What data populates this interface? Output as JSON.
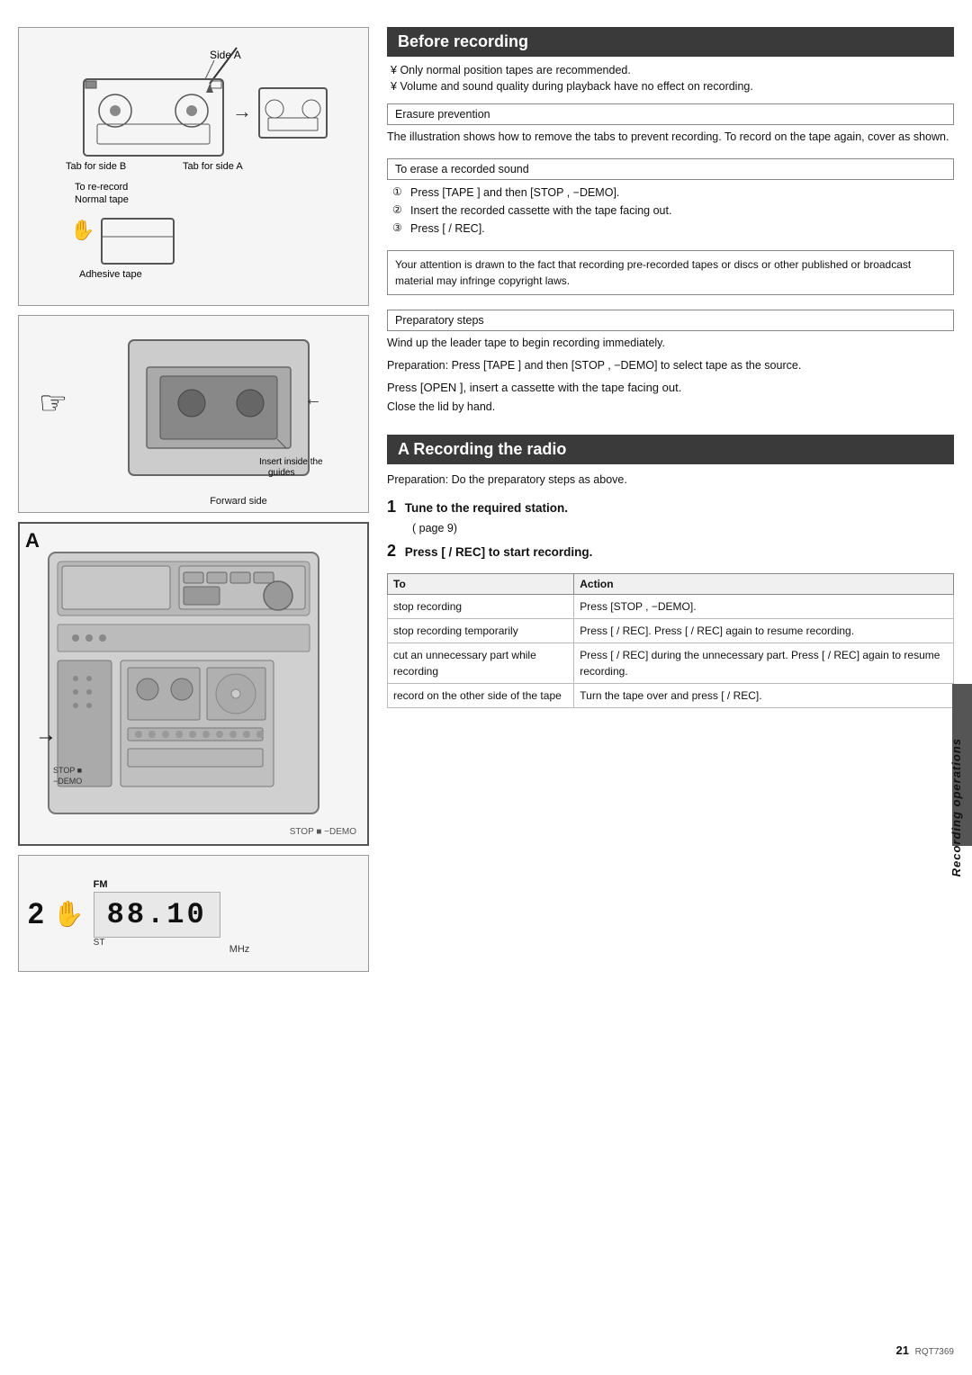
{
  "left": {
    "diagram_top": {
      "side_a_label": "Side A",
      "tab_for_side_b": "Tab for side B",
      "tab_for_side_a": "Tab for side A",
      "to_re_record": "To re-record",
      "normal_tape": "Normal tape",
      "adhesive_tape": "Adhesive tape",
      "insert_inside_guides": "Insert inside the guides",
      "forward_side": "Forward side"
    },
    "diagram_A_label": "A",
    "stop_demo_label": "STOP ■\n−DEMO",
    "arrow_2": "2",
    "stereo": {
      "number": "2",
      "fm_label": "FM",
      "frequency": "88.10",
      "mhz": "MHz",
      "st": "ST"
    }
  },
  "right": {
    "before_recording": {
      "title": "Before recording",
      "bullet1": "Only normal position tapes are recommended.",
      "bullet2": "Volume and sound quality during playback have no effect on recording.",
      "erasure_prevention": {
        "title": "Erasure prevention",
        "body": "The illustration shows how to remove the tabs to prevent recording. To record on the tape again, cover as shown."
      },
      "erase_recorded_sound": {
        "title": "To erase a recorded sound",
        "step1": "Press [TAPE   ] and then [STOP   , −DEMO].",
        "step2": "Insert the recorded cassette with the tape facing out.",
        "step3": "Press [  /   REC]."
      },
      "note": "Your attention is drawn to the fact that recording pre-recorded tapes or discs or other published or broadcast material may infringe copyright laws.",
      "preparatory_steps": {
        "title": "Preparatory steps",
        "wind_up": "Wind up the leader tape to begin recording immediately.",
        "preparation": "Preparation:  Press [TAPE   ] and then [STOP   , −DEMO] to select tape as the source."
      },
      "press_open": "Press [OPEN   ], insert a cassette with the tape facing out.",
      "close_lid": "Close the lid by hand."
    },
    "recording_radio": {
      "title": "A  Recording the radio",
      "preparation": "Preparation:  Do the preparatory steps as above.",
      "step1_label": "1",
      "step1_text": "Tune to the required station.",
      "step1_sub": "(   page 9)",
      "step2_label": "2",
      "step2_text": "Press [  /   REC] to start recording.",
      "table": {
        "col1": "To",
        "col2": "Action",
        "rows": [
          {
            "to": "stop recording",
            "action": "Press [STOP   , −DEMO]."
          },
          {
            "to": "stop recording temporarily",
            "action": "Press [  /   REC].\nPress [  /   REC] again to resume recording."
          },
          {
            "to": "cut an unnecessary part while recording",
            "action": "Press [  /   REC] during the unnecessary part.\nPress [  /   REC] again to resume recording."
          },
          {
            "to": "record on the other side of the tape",
            "action": "Turn the tape over and press [  /   REC]."
          }
        ]
      }
    },
    "sidebar_text": "Recording operations",
    "page_number": "21",
    "model_number": "RQT7369"
  }
}
